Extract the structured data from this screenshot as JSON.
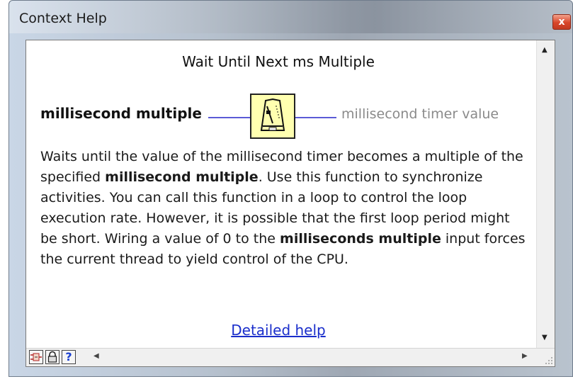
{
  "window": {
    "title": "Context Help",
    "close_glyph": "x"
  },
  "help": {
    "heading": "Wait Until Next ms Multiple",
    "input_terminal": "millisecond multiple",
    "output_terminal": "millisecond timer value",
    "icon": "metronome-icon",
    "description": {
      "p1": "Waits until the value of the millisecond timer becomes a multiple of the specified ",
      "b1": "millisecond multiple",
      "p2": ". Use this function to synchronize activities. You can call this function in a loop to control the loop execution rate. However, it is possible that the first loop period might be short. Wiring a value of 0 to the ",
      "b2": "milliseconds multiple",
      "p3": " input forces the current thread to yield control of the CPU."
    },
    "link": "Detailed help"
  },
  "toolbar": {
    "buttons": [
      "show-optional-terminals-icon",
      "lock-icon",
      "help-icon"
    ],
    "help_glyph": "?"
  },
  "colors": {
    "wire": "#5b5bd6",
    "link": "#1a2ecb",
    "icon_bg": "#ffffb0",
    "close_button": "#d8462a"
  }
}
